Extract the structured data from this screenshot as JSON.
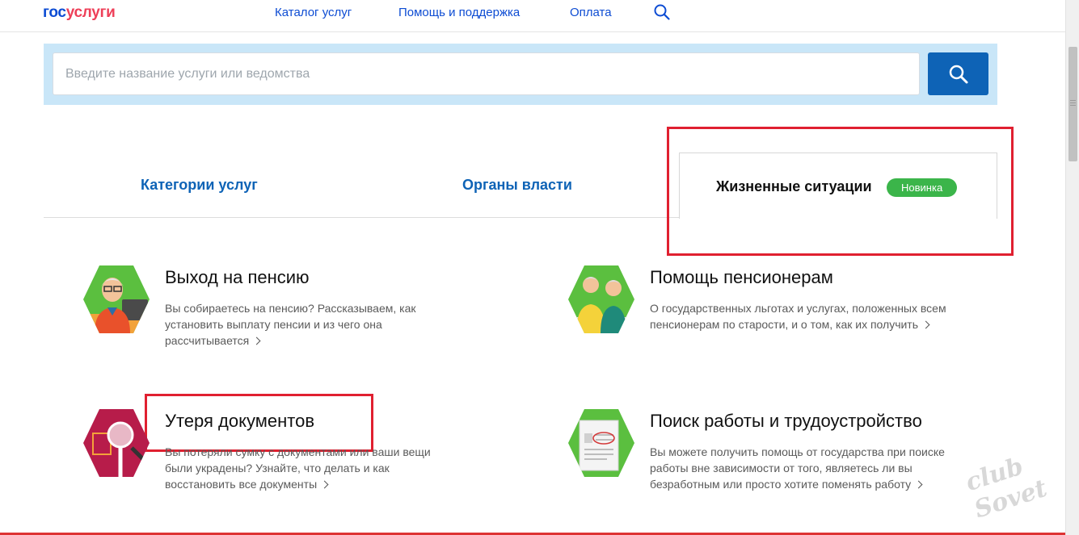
{
  "header": {
    "logo_part1": "гос",
    "logo_part2": "услуги",
    "nav": [
      "Каталог услуг",
      "Помощь и поддержка",
      "Оплата"
    ],
    "search_icon": "search-icon"
  },
  "search": {
    "placeholder": "Введите название услуги или ведомства",
    "button_icon": "search-icon"
  },
  "tabs": {
    "categories": "Категории услуг",
    "authorities": "Органы власти",
    "life_situations": "Жизненные ситуации",
    "badge": "Новинка"
  },
  "cards": [
    {
      "title": "Выход на пенсию",
      "desc": "Вы собираетесь на пенсию? Рассказываем, как установить выплату пенсии и из чего она рассчитывается",
      "icon": "retiree-icon"
    },
    {
      "title": "Помощь пенсионерам",
      "desc": "О государственных льготах и услугах, положенных всем пенсионерам по старости, и о том, как их получить",
      "icon": "elderly-couple-icon"
    },
    {
      "title": "Утеря документов",
      "desc": "Вы потеряли сумку с документами или ваши вещи были украдены? Узнайте, что делать и как восстановить все документы",
      "icon": "magnifier-document-icon"
    },
    {
      "title": "Поиск работы и трудоустройство",
      "desc": "Вы можете получить помощь от государства при поиске работы вне зависимости от того, являетесь ли вы безработным или просто хотите поменять работу",
      "icon": "resume-icon"
    }
  ],
  "watermark": "club Sovet",
  "colors": {
    "brand_blue": "#0d4cd3",
    "link_blue": "#0e63b6",
    "brand_red": "#ee3f58",
    "badge_green": "#3bb54a",
    "annotation_red": "#e02030",
    "search_panel_bg": "#c9e6f8"
  }
}
